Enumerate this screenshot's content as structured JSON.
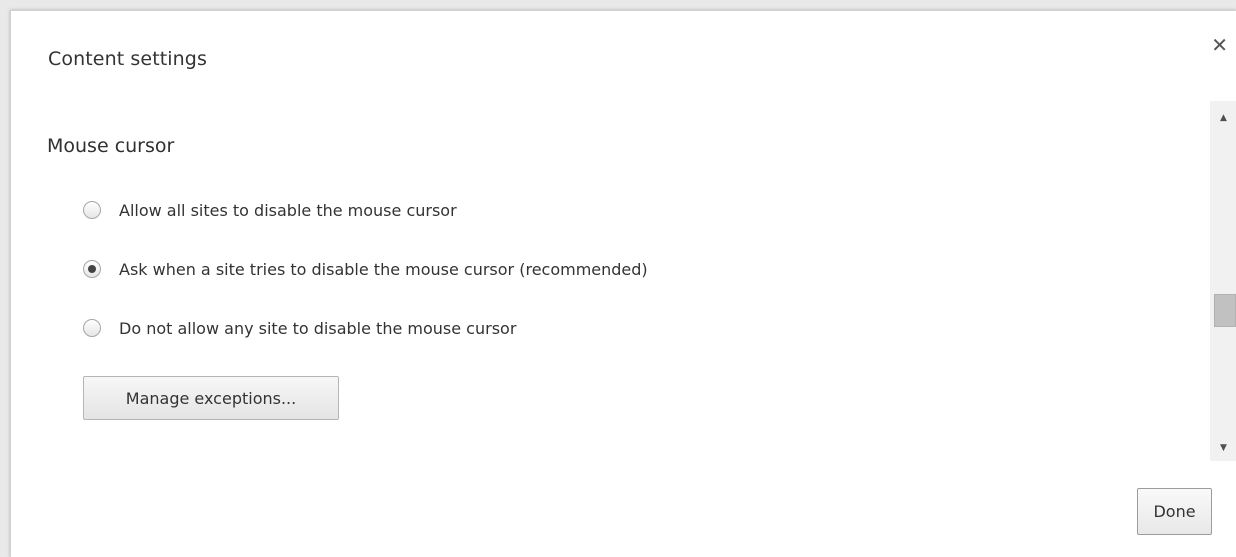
{
  "dialog": {
    "title": "Content settings",
    "close_icon": "close-icon"
  },
  "section": {
    "title": "Mouse cursor",
    "options": [
      {
        "label": "Allow all sites to disable the mouse cursor",
        "checked": false
      },
      {
        "label": "Ask when a site tries to disable the mouse cursor (recommended)",
        "checked": true
      },
      {
        "label": "Do not allow any site to disable the mouse cursor",
        "checked": false
      }
    ],
    "manage_label": "Manage exceptions..."
  },
  "scrollbar": {
    "up_icon": "scroll-up-icon",
    "down_icon": "scroll-down-icon"
  },
  "footer": {
    "done_label": "Done"
  }
}
